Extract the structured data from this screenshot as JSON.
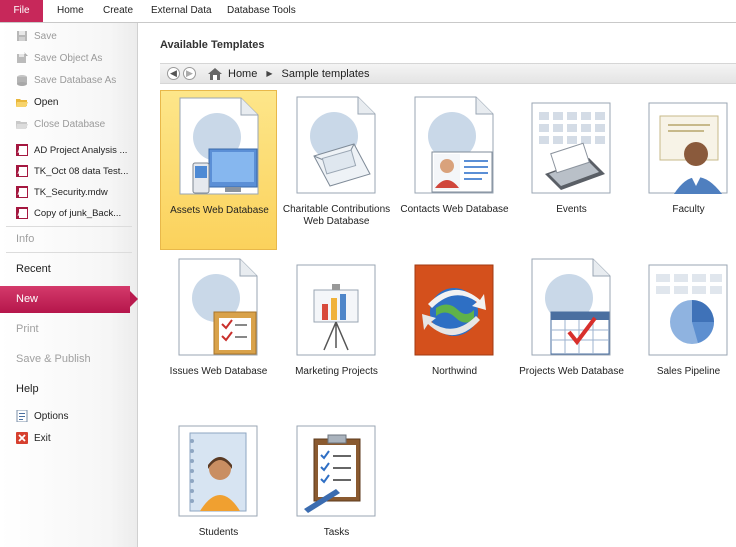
{
  "ribbon": {
    "tabs": [
      {
        "label": "File",
        "active": true
      },
      {
        "label": "Home"
      },
      {
        "label": "Create"
      },
      {
        "label": "External Data"
      },
      {
        "label": "Database Tools"
      }
    ]
  },
  "nav": {
    "commands": [
      {
        "label": "Save",
        "icon": "save-icon",
        "enabled": false
      },
      {
        "label": "Save Object As",
        "icon": "save-object-icon",
        "enabled": false
      },
      {
        "label": "Save Database As",
        "icon": "save-database-icon",
        "enabled": false
      },
      {
        "label": "Open",
        "icon": "folder-open-icon",
        "enabled": true
      },
      {
        "label": "Close Database",
        "icon": "close-database-icon",
        "enabled": false
      }
    ],
    "recent_files": [
      "AD Project Analysis ...",
      "TK_Oct 08 data Test...",
      "TK_Security.mdw",
      "Copy of junk_Back..."
    ],
    "sections": {
      "info": "Info",
      "recent": "Recent",
      "new": "New",
      "print": "Print",
      "save_publish": "Save & Publish",
      "help": "Help"
    },
    "bottom": [
      {
        "label": "Options",
        "icon": "options-icon"
      },
      {
        "label": "Exit",
        "icon": "exit-icon"
      }
    ]
  },
  "main": {
    "title": "Available Templates",
    "breadcrumb": {
      "home": "Home",
      "current": "Sample templates"
    },
    "templates": [
      {
        "label": "Assets Web Database",
        "selected": true
      },
      {
        "label": "Charitable Contributions Web Database"
      },
      {
        "label": "Contacts Web Database"
      },
      {
        "label": "Events"
      },
      {
        "label": "Faculty"
      },
      {
        "label": "Issues Web Database"
      },
      {
        "label": "Marketing Projects"
      },
      {
        "label": "Northwind"
      },
      {
        "label": "Projects Web Database"
      },
      {
        "label": "Sales Pipeline"
      },
      {
        "label": "Students"
      },
      {
        "label": "Tasks"
      }
    ]
  },
  "colors": {
    "accent": "#c7285a",
    "selection": "#fbd25c"
  }
}
